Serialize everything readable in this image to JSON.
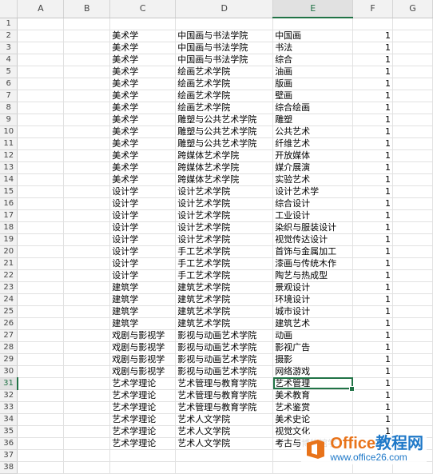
{
  "sheet": {
    "columns": [
      "A",
      "B",
      "C",
      "D",
      "E",
      "F",
      "G"
    ],
    "active_column": "E",
    "active_row": 31,
    "rows": [
      {
        "n": "1",
        "c": "",
        "d": "",
        "e": "",
        "f": ""
      },
      {
        "n": "2",
        "c": "美术学",
        "d": "中国画与书法学院",
        "e": "中国画",
        "f": "1"
      },
      {
        "n": "3",
        "c": "美术学",
        "d": "中国画与书法学院",
        "e": "书法",
        "f": "1"
      },
      {
        "n": "4",
        "c": "美术学",
        "d": "中国画与书法学院",
        "e": "综合",
        "f": "1"
      },
      {
        "n": "5",
        "c": "美术学",
        "d": "绘画艺术学院",
        "e": "油画",
        "f": "1"
      },
      {
        "n": "6",
        "c": "美术学",
        "d": "绘画艺术学院",
        "e": "版画",
        "f": "1"
      },
      {
        "n": "7",
        "c": "美术学",
        "d": "绘画艺术学院",
        "e": "壁画",
        "f": "1"
      },
      {
        "n": "8",
        "c": "美术学",
        "d": "绘画艺术学院",
        "e": "综合绘画",
        "f": "1"
      },
      {
        "n": "9",
        "c": "美术学",
        "d": "雕塑与公共艺术学院",
        "e": "雕塑",
        "f": "1"
      },
      {
        "n": "10",
        "c": "美术学",
        "d": "雕塑与公共艺术学院",
        "e": "公共艺术",
        "f": "1"
      },
      {
        "n": "11",
        "c": "美术学",
        "d": "雕塑与公共艺术学院",
        "e": "纤维艺术",
        "f": "1"
      },
      {
        "n": "12",
        "c": "美术学",
        "d": "跨媒体艺术学院",
        "e": "开放媒体",
        "f": "1"
      },
      {
        "n": "13",
        "c": "美术学",
        "d": "跨媒体艺术学院",
        "e": "媒介展演",
        "f": "1"
      },
      {
        "n": "14",
        "c": "美术学",
        "d": "跨媒体艺术学院",
        "e": "实验艺术",
        "f": "1"
      },
      {
        "n": "15",
        "c": "设计学",
        "d": "设计艺术学院",
        "e": "设计艺术学",
        "f": "1"
      },
      {
        "n": "16",
        "c": "设计学",
        "d": "设计艺术学院",
        "e": "综合设计",
        "f": "1"
      },
      {
        "n": "17",
        "c": "设计学",
        "d": "设计艺术学院",
        "e": "工业设计",
        "f": "1"
      },
      {
        "n": "18",
        "c": "设计学",
        "d": "设计艺术学院",
        "e": "染织与服装设计",
        "f": "1"
      },
      {
        "n": "19",
        "c": "设计学",
        "d": "设计艺术学院",
        "e": "视觉传达设计",
        "f": "1"
      },
      {
        "n": "20",
        "c": "设计学",
        "d": "手工艺术学院",
        "e": "首饰与金属加工",
        "f": "1"
      },
      {
        "n": "21",
        "c": "设计学",
        "d": "手工艺术学院",
        "e": "漆画与传统木作",
        "f": "1"
      },
      {
        "n": "22",
        "c": "设计学",
        "d": "手工艺术学院",
        "e": "陶艺与热成型",
        "f": "1"
      },
      {
        "n": "23",
        "c": "建筑学",
        "d": "建筑艺术学院",
        "e": "景观设计",
        "f": "1"
      },
      {
        "n": "24",
        "c": "建筑学",
        "d": "建筑艺术学院",
        "e": "环境设计",
        "f": "1"
      },
      {
        "n": "25",
        "c": "建筑学",
        "d": "建筑艺术学院",
        "e": "城市设计",
        "f": "1"
      },
      {
        "n": "26",
        "c": "建筑学",
        "d": "建筑艺术学院",
        "e": "建筑艺术",
        "f": "1"
      },
      {
        "n": "27",
        "c": "戏剧与影视学",
        "d": "影视与动画艺术学院",
        "e": "动画",
        "f": "1"
      },
      {
        "n": "28",
        "c": "戏剧与影视学",
        "d": "影视与动画艺术学院",
        "e": "影视广告",
        "f": "1"
      },
      {
        "n": "29",
        "c": "戏剧与影视学",
        "d": "影视与动画艺术学院",
        "e": "摄影",
        "f": "1"
      },
      {
        "n": "30",
        "c": "戏剧与影视学",
        "d": "影视与动画艺术学院",
        "e": "网络游戏",
        "f": "1"
      },
      {
        "n": "31",
        "c": "艺术学理论",
        "d": "艺术管理与教育学院",
        "e": "艺术管理",
        "f": "1"
      },
      {
        "n": "32",
        "c": "艺术学理论",
        "d": "艺术管理与教育学院",
        "e": "美术教育",
        "f": "1"
      },
      {
        "n": "33",
        "c": "艺术学理论",
        "d": "艺术管理与教育学院",
        "e": "艺术鉴赏",
        "f": "1"
      },
      {
        "n": "34",
        "c": "艺术学理论",
        "d": "艺术人文学院",
        "e": "美术史论",
        "f": "1"
      },
      {
        "n": "35",
        "c": "艺术学理论",
        "d": "艺术人文学院",
        "e": "视觉文化",
        "f": "1"
      },
      {
        "n": "36",
        "c": "艺术学理论",
        "d": "艺术人文学院",
        "e": "考古与博物馆学",
        "f": "1"
      },
      {
        "n": "37",
        "c": "",
        "d": "",
        "e": "",
        "f": ""
      },
      {
        "n": "38",
        "c": "",
        "d": "",
        "e": "",
        "f": ""
      }
    ]
  },
  "watermark": {
    "brand_part1": "Office",
    "brand_part2": "教程网",
    "url": "www.office26.com",
    "logo_icon": "office-logo-icon",
    "logo_color": "#e8731a"
  },
  "colors": {
    "accent": "#217346",
    "header_bg": "#f2f2f2",
    "gridline": "#e1e1e1"
  }
}
